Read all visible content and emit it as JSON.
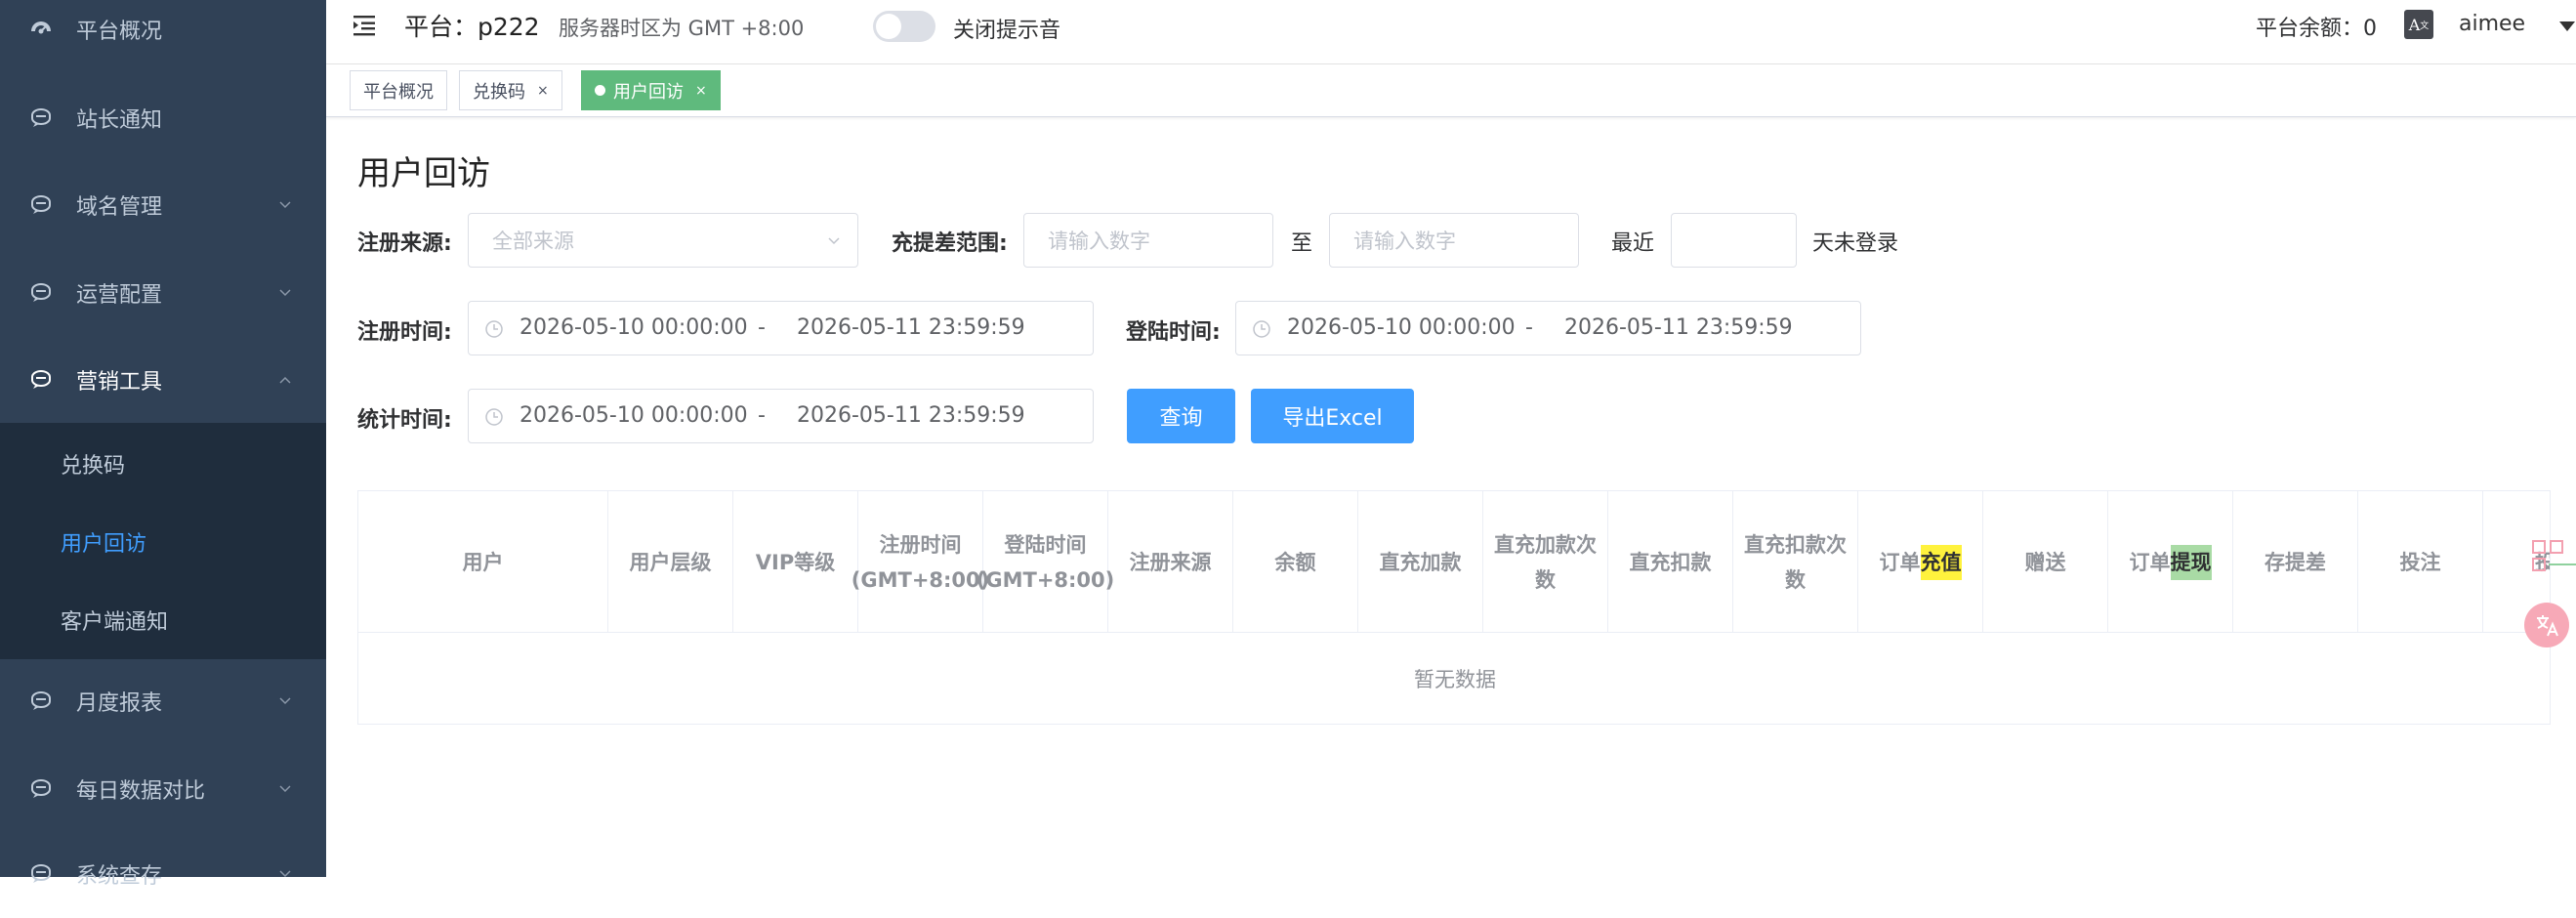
{
  "sidebar": {
    "items": [
      {
        "label": "平台概况",
        "icon": "dashboard-icon",
        "has_arrow": false
      },
      {
        "label": "站长通知",
        "icon": "chat-icon",
        "has_arrow": false
      },
      {
        "label": "域名管理",
        "icon": "chat-icon",
        "has_arrow": true
      },
      {
        "label": "运营配置",
        "icon": "chat-icon",
        "has_arrow": true
      },
      {
        "label": "营销工具",
        "icon": "chat-icon",
        "has_arrow": true,
        "expanded": true
      },
      {
        "label": "月度报表",
        "icon": "chat-icon",
        "has_arrow": true
      },
      {
        "label": "每日数据对比",
        "icon": "chat-icon",
        "has_arrow": true
      },
      {
        "label": "系统查存",
        "icon": "chat-icon",
        "has_arrow": true
      }
    ],
    "submenu": [
      {
        "label": "兑换码"
      },
      {
        "label": "用户回访",
        "active": true
      },
      {
        "label": "客户端通知"
      }
    ]
  },
  "topbar": {
    "platform": "平台：p222",
    "timezone": "服务器时区为 GMT +8:00",
    "sound_toggle_label": "关闭提示音",
    "balance": "平台余额：0",
    "lang_icon": "translate-icon",
    "user": "aimee"
  },
  "tags": [
    {
      "label": "平台概况",
      "closable": false
    },
    {
      "label": "兑换码",
      "closable": true
    },
    {
      "label": "用户回访",
      "closable": true,
      "active": true
    }
  ],
  "tag_close": "×",
  "page": {
    "title": "用户回访",
    "filters": {
      "source_label": "注册来源:",
      "source_placeholder": "全部来源",
      "diff_label": "充提差范围:",
      "diff_min_placeholder": "请输入数字",
      "diff_to": "至",
      "diff_max_placeholder": "请输入数字",
      "recent_label": "最近",
      "recent_suffix": "天未登录",
      "reg_time_label": "注册时间:",
      "reg_time_start": "2026-05-10 00:00:00",
      "reg_time_end": "2026-05-11 23:59:59",
      "login_time_label": "登陆时间:",
      "login_time_start": "2026-05-10 00:00:00",
      "login_time_end": "2026-05-11 23:59:59",
      "stat_time_label": "统计时间:",
      "stat_time_start": "2026-05-10 00:00:00",
      "stat_time_end": "2026-05-11 23:59:59",
      "range_sep": "-"
    },
    "buttons": {
      "query": "查询",
      "export": "导出Excel"
    },
    "table": {
      "columns": [
        {
          "label": "用户"
        },
        {
          "label": "用户层级"
        },
        {
          "label": "VIP等级"
        },
        {
          "label": "注册时间(GMT+8:00)"
        },
        {
          "label": "登陆时间(GMT+8:00)"
        },
        {
          "label": "注册来源"
        },
        {
          "label": "余额"
        },
        {
          "label": "直充加款"
        },
        {
          "label": "直充加款次数"
        },
        {
          "label": "直充扣款"
        },
        {
          "label": "直充扣款次数"
        },
        {
          "label_pre": "订单",
          "label_hl": "充值",
          "hl": "yellow"
        },
        {
          "label": "赠送"
        },
        {
          "label_pre": "订单",
          "label_hl": "提现",
          "hl": "green"
        },
        {
          "label": "存提差"
        },
        {
          "label": "投注"
        },
        {
          "label": "投"
        }
      ],
      "empty_text": "暂无数据"
    }
  }
}
